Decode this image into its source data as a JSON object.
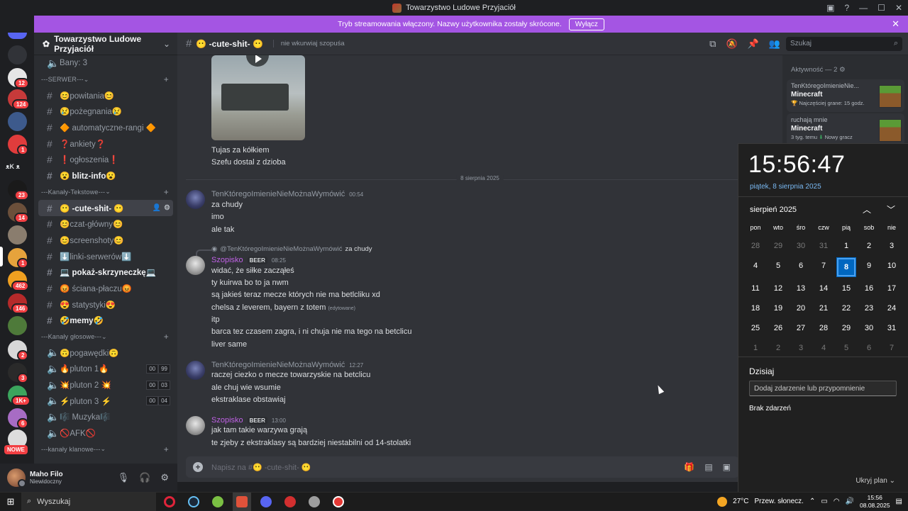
{
  "window": {
    "title": "Towarzystwo Ludowe Przyjaciół"
  },
  "stream_banner": {
    "text": "Tryb streamowania włączony. Nazwy użytkownika zostały skrócone.",
    "button": "Wyłącz"
  },
  "rail": {
    "badges": [
      "12",
      "124",
      "1",
      "23",
      "14",
      "1",
      "462",
      "146",
      "2",
      "3",
      "1K+",
      "6"
    ],
    "nowe": "NOWE",
    "kk": "ᴥK ᴥ"
  },
  "server": {
    "name": "Towarzystwo Ludowe Przyjaciół"
  },
  "channels": {
    "bany": "Bany: 3",
    "cat_serwer": "---SERWER---",
    "serwer": [
      "😊powitania😊",
      "😢pożegnania😢",
      "🔶 automatyczne-rangi 🔶",
      "❓ankiety❓",
      "❗ogłoszenia❗",
      "😮 blitz-info😮"
    ],
    "cat_tekst": "---Kanały-Tekstowe---",
    "tekst": [
      "😶 -cute-shit- 😶",
      "😊czat-główny😊",
      "😊screenshoty😊",
      "⬇️linki-serwerów⬇️",
      "💻 pokaż-skrzyneczkę💻",
      "😡 ściana-płaczu😡",
      "😍 statystyki😍",
      "🤣memy🤣"
    ],
    "cat_glos": "---Kanały głosowe---",
    "glos": [
      "🙃pogawędki🙃",
      "🔥pluton 1🔥",
      "💥pluton 2 💥",
      "⚡pluton 3 ⚡",
      "🎼 Muzyka🎼",
      "🚫AFK🚫"
    ],
    "voice_counts": [
      [
        "00",
        "99"
      ],
      [
        "00",
        "03"
      ],
      [
        "00",
        "04"
      ]
    ],
    "cat_klan": "---kanały klanowe---"
  },
  "user": {
    "name": "Maho Filo",
    "status": "Niewidoczny"
  },
  "header": {
    "channel": "😶 -cute-shit- 😶",
    "topic": "nie wkurwiaj szopuśa",
    "search": "Szukaj"
  },
  "messages": {
    "caption1": "Tujas za kółkiem",
    "caption2": "Szefu dostal z dzioba",
    "date_divider": "8 sierpnia 2025",
    "m1_author": "TenKtóregoImienieNieMożnaWymówić",
    "m1_time": "00:54",
    "m1_lines": [
      "za chudy",
      "imo",
      "ale tak"
    ],
    "reply_to": "@TenKtóregoImienieNieMożnaWymówić",
    "reply_text": "za chudy",
    "m2_author": "Szopisko",
    "m2_tag": "BEER",
    "m2_time": "08:25",
    "m2_lines": [
      "widać, że siłke zacząłeś",
      "ty kuirwa bo to ja nwm",
      "są jakieś teraz mecze których nie ma betlcliku xd",
      "chelsa z leverem, bayern z totem",
      "itp",
      "barca tez czasem zagra, i ni chuja nie ma tego na betclicu",
      "liver same"
    ],
    "edited": "(edytowane)",
    "m3_author": "TenKtóregoImienieNieMożnaWymówić",
    "m3_time": "12:27",
    "m3_lines": [
      "raczej ciezko o mecze towarzyskie na betclicu",
      "ale chuj wie wsumie",
      "ekstraklase obstawiaj"
    ],
    "m4_author": "Szopisko",
    "m4_tag": "BEER",
    "m4_time": "13:00",
    "m4_lines": [
      "jak tam takie warzywa grają",
      "te zjeby z ekstraklasy są bardziej niestabilni od 14-stolatki"
    ]
  },
  "composer": {
    "placeholder": "Napisz na #😶 -cute-shit- 😶"
  },
  "activity": {
    "header": "Aktywność — 2",
    "cards": [
      {
        "user": "TenKtóregoImienieNie...",
        "game": "Minecraft",
        "sub": "Najczęściej grane: 15 godz."
      },
      {
        "user": "ruchają mnie",
        "game": "Minecraft",
        "sub": "3 tyg. temu",
        "sub2": "Nowy gracz"
      }
    ]
  },
  "calendar": {
    "time": "15:56:47",
    "date": "piątek, 8 sierpnia 2025",
    "month": "sierpień 2025",
    "weekdays": [
      "pon",
      "wto",
      "śro",
      "czw",
      "pią",
      "sob",
      "nie"
    ],
    "days": [
      "28",
      "29",
      "30",
      "31",
      "1",
      "2",
      "3",
      "4",
      "5",
      "6",
      "7",
      "8",
      "9",
      "10",
      "11",
      "12",
      "13",
      "14",
      "15",
      "16",
      "17",
      "18",
      "19",
      "20",
      "21",
      "22",
      "23",
      "24",
      "25",
      "26",
      "27",
      "28",
      "29",
      "30",
      "31",
      "1",
      "2",
      "3",
      "4",
      "5",
      "6",
      "7"
    ],
    "today": "8",
    "dzisiaj": "Dzisiaj",
    "add_placeholder": "Dodaj zdarzenie lub przypomnienie",
    "no_events": "Brak zdarzeń",
    "hide": "Ukryj plan"
  },
  "taskbar": {
    "search": "Wyszukaj",
    "weather": "27°C",
    "weather_text": "Przew. słonecz.",
    "time": "15:56",
    "date": "08.08.2025"
  }
}
